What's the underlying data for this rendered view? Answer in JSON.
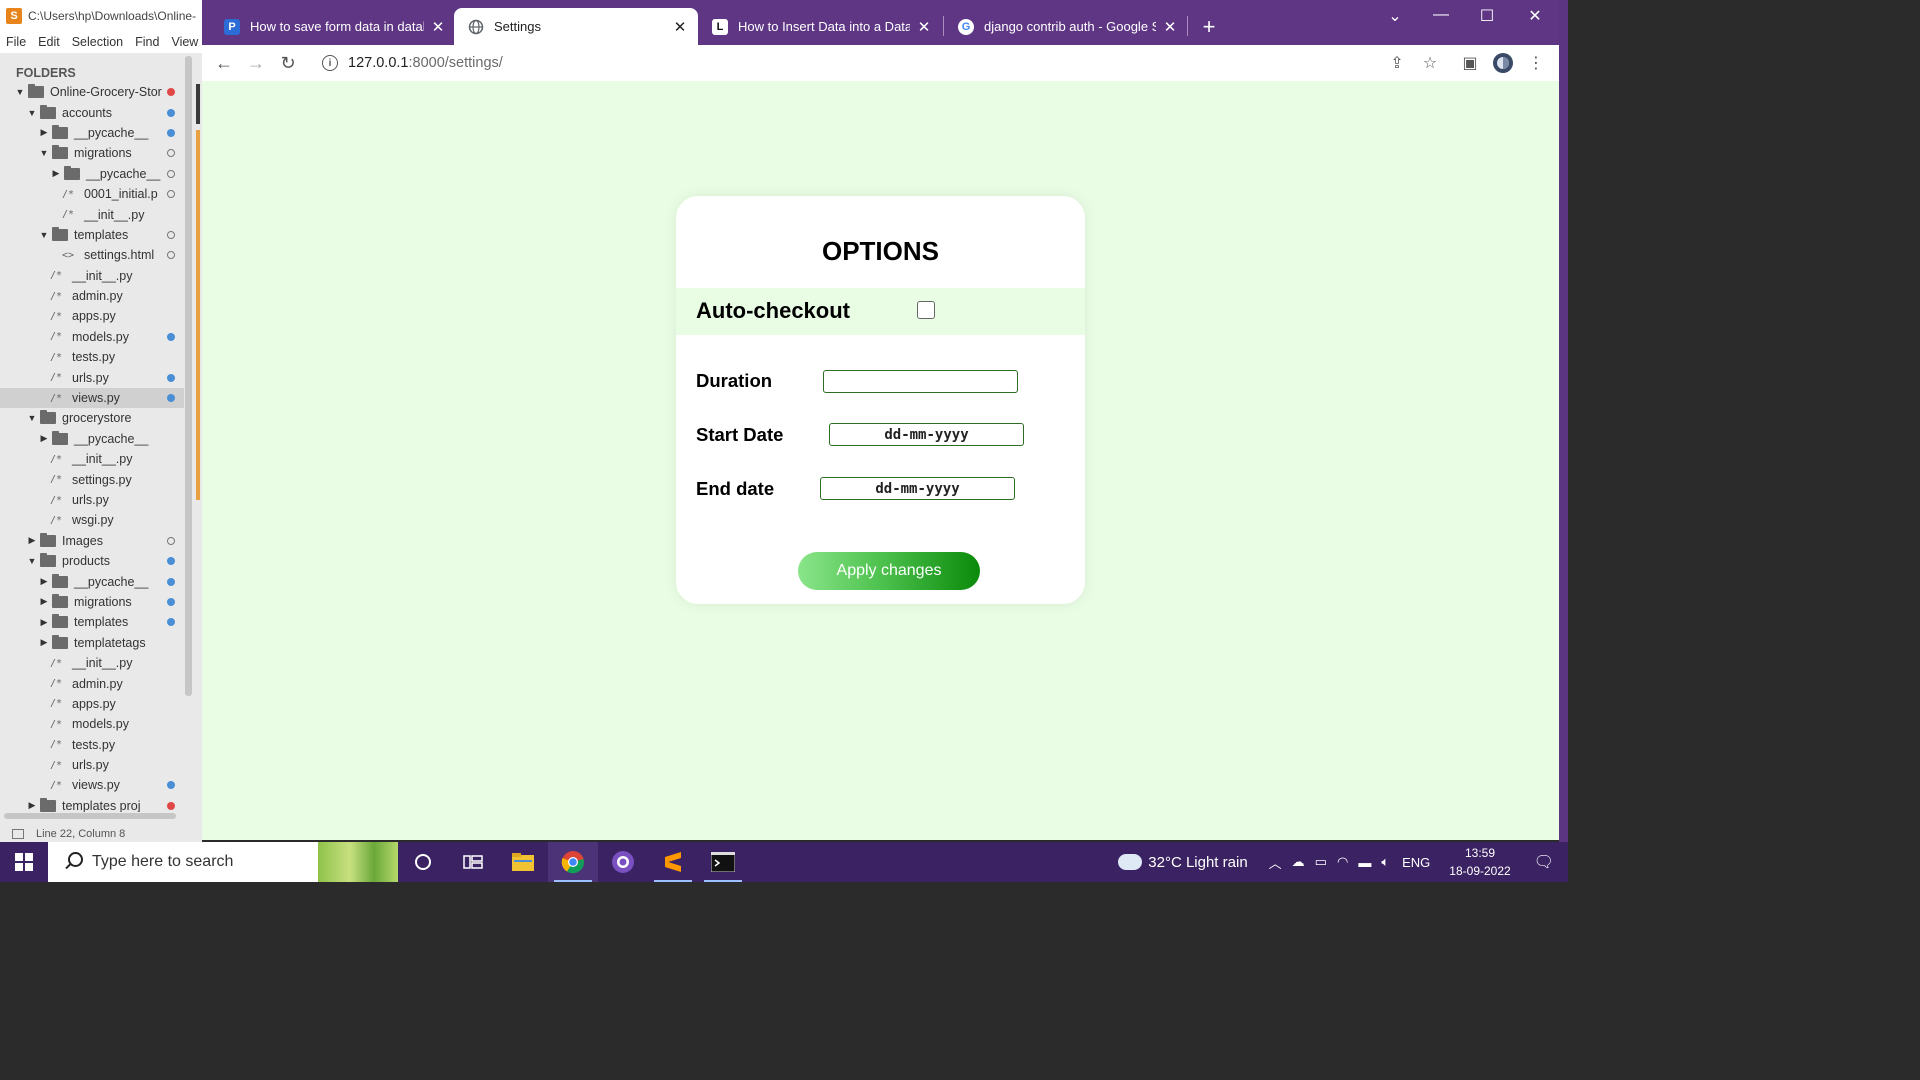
{
  "sublime": {
    "title": "C:\\Users\\hp\\Downloads\\Online-",
    "menu": [
      "File",
      "Edit",
      "Selection",
      "Find",
      "View"
    ],
    "folders_header": "FOLDERS",
    "tree": [
      {
        "label": "Online-Grocery-Stor",
        "kind": "folder-open",
        "depth": 0,
        "dot": "red"
      },
      {
        "label": "accounts",
        "kind": "folder-open",
        "depth": 1,
        "dot": "blue"
      },
      {
        "label": "__pycache__",
        "kind": "folder-closed",
        "depth": 2,
        "dot": "blue"
      },
      {
        "label": "migrations",
        "kind": "folder-open",
        "depth": 2,
        "dot": "hollow"
      },
      {
        "label": "__pycache__",
        "kind": "folder-closed",
        "depth": 3,
        "dot": "hollow"
      },
      {
        "label": "0001_initial.p",
        "kind": "file",
        "depth": 3,
        "dot": "hollow"
      },
      {
        "label": "__init__.py",
        "kind": "file",
        "depth": 3,
        "dot": ""
      },
      {
        "label": "templates",
        "kind": "folder-open",
        "depth": 2,
        "dot": "hollow"
      },
      {
        "label": "settings.html",
        "kind": "html",
        "depth": 3,
        "dot": "hollow"
      },
      {
        "label": "__init__.py",
        "kind": "file",
        "depth": 2,
        "dot": ""
      },
      {
        "label": "admin.py",
        "kind": "file",
        "depth": 2,
        "dot": ""
      },
      {
        "label": "apps.py",
        "kind": "file",
        "depth": 2,
        "dot": ""
      },
      {
        "label": "models.py",
        "kind": "file",
        "depth": 2,
        "dot": "blue"
      },
      {
        "label": "tests.py",
        "kind": "file",
        "depth": 2,
        "dot": ""
      },
      {
        "label": "urls.py",
        "kind": "file",
        "depth": 2,
        "dot": "blue"
      },
      {
        "label": "views.py",
        "kind": "file",
        "depth": 2,
        "dot": "blue",
        "selected": true
      },
      {
        "label": "grocerystore",
        "kind": "folder-open",
        "depth": 1,
        "dot": ""
      },
      {
        "label": "__pycache__",
        "kind": "folder-closed",
        "depth": 2,
        "dot": ""
      },
      {
        "label": "__init__.py",
        "kind": "file",
        "depth": 2,
        "dot": ""
      },
      {
        "label": "settings.py",
        "kind": "file",
        "depth": 2,
        "dot": ""
      },
      {
        "label": "urls.py",
        "kind": "file",
        "depth": 2,
        "dot": ""
      },
      {
        "label": "wsgi.py",
        "kind": "file",
        "depth": 2,
        "dot": ""
      },
      {
        "label": "Images",
        "kind": "folder-closed",
        "depth": 1,
        "dot": "hollow"
      },
      {
        "label": "products",
        "kind": "folder-open",
        "depth": 1,
        "dot": "blue"
      },
      {
        "label": "__pycache__",
        "kind": "folder-closed",
        "depth": 2,
        "dot": "blue"
      },
      {
        "label": "migrations",
        "kind": "folder-closed",
        "depth": 2,
        "dot": "blue"
      },
      {
        "label": "templates",
        "kind": "folder-closed",
        "depth": 2,
        "dot": "blue"
      },
      {
        "label": "templatetags",
        "kind": "folder-closed",
        "depth": 2,
        "dot": ""
      },
      {
        "label": "__init__.py",
        "kind": "file",
        "depth": 2,
        "dot": ""
      },
      {
        "label": "admin.py",
        "kind": "file",
        "depth": 2,
        "dot": ""
      },
      {
        "label": "apps.py",
        "kind": "file",
        "depth": 2,
        "dot": ""
      },
      {
        "label": "models.py",
        "kind": "file",
        "depth": 2,
        "dot": ""
      },
      {
        "label": "tests.py",
        "kind": "file",
        "depth": 2,
        "dot": ""
      },
      {
        "label": "urls.py",
        "kind": "file",
        "depth": 2,
        "dot": ""
      },
      {
        "label": "views.py",
        "kind": "file",
        "depth": 2,
        "dot": "blue"
      },
      {
        "label": "templates proj",
        "kind": "folder-closed",
        "depth": 1,
        "dot": "red"
      }
    ],
    "status": "Line 22, Column 8"
  },
  "browser": {
    "tabs": [
      {
        "title": "How to save form data in databa",
        "favicon": "P",
        "favicon_color": "#2b6cd6"
      },
      {
        "title": "Settings",
        "favicon": "globe",
        "favicon_color": "#5f6368",
        "active": true
      },
      {
        "title": "How to Insert Data into a Databa",
        "favicon": "L",
        "favicon_color": "#111111"
      },
      {
        "title": "django contrib auth - Google Sea",
        "favicon": "G",
        "favicon_color": "#4285f4"
      }
    ],
    "url_host": "127.0.0.1",
    "url_path": ":8000/settings/"
  },
  "page": {
    "title": "OPTIONS",
    "auto_checkout_label": "Auto-checkout",
    "auto_checkout_checked": false,
    "duration_label": "Duration",
    "duration_value": "",
    "start_date_label": "Start Date",
    "start_date_placeholder": "dd-mm-yyyy",
    "end_date_label": "End date",
    "end_date_placeholder": "dd-mm-yyyy",
    "apply_button": "Apply changes"
  },
  "colors": {
    "page_bg": "#e9fde5",
    "accent_green": "#0a8a0a",
    "chrome_frame": "#5e3684"
  },
  "taskbar": {
    "search_placeholder": "Type here to search",
    "weather": "32°C  Light rain",
    "language": "ENG",
    "time": "13:59",
    "date": "18-09-2022"
  }
}
